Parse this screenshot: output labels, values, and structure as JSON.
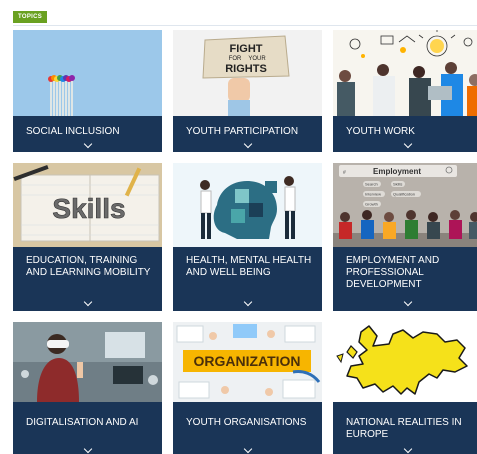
{
  "header": {
    "badge": "TOPICS"
  },
  "colors": {
    "badge": "#6aa121",
    "caption": "#1a3557",
    "caption_text": "#ffffff"
  },
  "topics": [
    {
      "label": "SOCIAL INCLUSION"
    },
    {
      "label": "YOUTH PARTICIPATION",
      "image_text": [
        "FIGHT",
        "FOR",
        "YOUR",
        "RIGHTS"
      ]
    },
    {
      "label": "YOUTH WORK"
    },
    {
      "label": "EDUCATION, TRAINING AND LEARNING MOBILITY",
      "image_text": "Skills"
    },
    {
      "label": "HEALTH, MENTAL HEALTH AND WELL BEING"
    },
    {
      "label": "EMPLOYMENT AND PROFESSIONAL DEVELOPMENT",
      "image_text": "Employment",
      "image_tags": [
        "Search",
        "Skills",
        "Interview",
        "Qualification",
        "Growth"
      ]
    },
    {
      "label": "DIGITALISATION AND AI"
    },
    {
      "label": "YOUTH ORGANISATIONS",
      "image_text": "ORGANIZATION"
    },
    {
      "label": "NATIONAL REALITIES IN EUROPE"
    }
  ],
  "icons": {
    "expand": "chevron-down-icon"
  }
}
